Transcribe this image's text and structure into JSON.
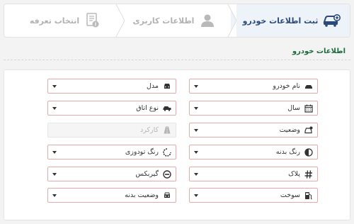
{
  "steps": [
    {
      "label": "ثبت اطلاعات خودرو",
      "icon": "car-add-icon",
      "active": true
    },
    {
      "label": "اطلاعات کاربری",
      "icon": "user-icon",
      "active": false
    },
    {
      "label": "انتخاب تعرفه",
      "icon": "tariff-receipt-icon",
      "active": false
    }
  ],
  "section": {
    "title": "اطلاعات خودرو"
  },
  "fields": {
    "car_name": {
      "label": "نام خودرو",
      "icon": "car-icon"
    },
    "model": {
      "label": "مدل",
      "icon": "car-front-icon"
    },
    "year": {
      "label": "سال",
      "icon": "calendar-icon"
    },
    "room_type": {
      "label": "نوع اتاق",
      "icon": "car-body-icon"
    },
    "condition": {
      "label": "وضعیت",
      "icon": "car-status-icon"
    },
    "mileage": {
      "placeholder": "کارکرد",
      "icon": "road-icon"
    },
    "body_color": {
      "label": "رنگ بدنه",
      "icon": "half-circle-icon"
    },
    "interior_color": {
      "label": "رنگ تودوزی",
      "icon": "circle-notch-icon"
    },
    "plate": {
      "label": "پلاک",
      "icon": "hash-icon"
    },
    "gearbox": {
      "label": "گیربکس",
      "icon": "gear-minus-icon"
    },
    "fuel": {
      "label": "سوخت",
      "icon": "fuel-pump-icon"
    },
    "body_status": {
      "label": "وضعیت بدنه",
      "icon": "car-side-icon"
    }
  },
  "colors": {
    "accent": "#2b4a7a",
    "field_border": "#e8a9a9",
    "section_title": "#1b6a3a"
  }
}
